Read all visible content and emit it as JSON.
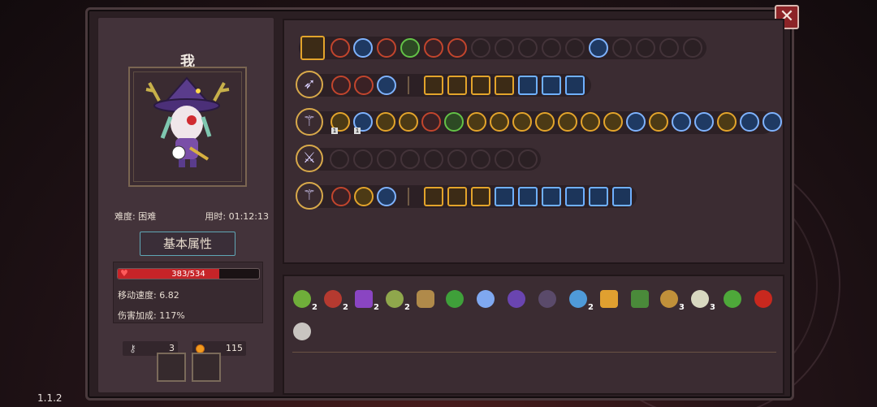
{
  "player": {
    "name": "我",
    "difficulty": "难度: 困难",
    "time": "用时: 01:12:13"
  },
  "tabs": {
    "attributes": "基本属性"
  },
  "stats": {
    "hp_text": "383/534",
    "hp_fraction": 0.717,
    "move_speed": "移动速度: 6.82",
    "damage_bonus": "伤害加成: 117%"
  },
  "resources": {
    "keys": "3",
    "coins": "115"
  },
  "version": "1.1.2",
  "close_icon": "close-icon",
  "colors": {
    "hp": "#c62428",
    "frame_gold": "#d8a94a",
    "skill_blue": "#7fb3ff",
    "skill_red": "#c2452d"
  },
  "bag": {
    "item_counts": [
      "2",
      "2",
      "2",
      "2",
      "2",
      "3"
    ]
  }
}
